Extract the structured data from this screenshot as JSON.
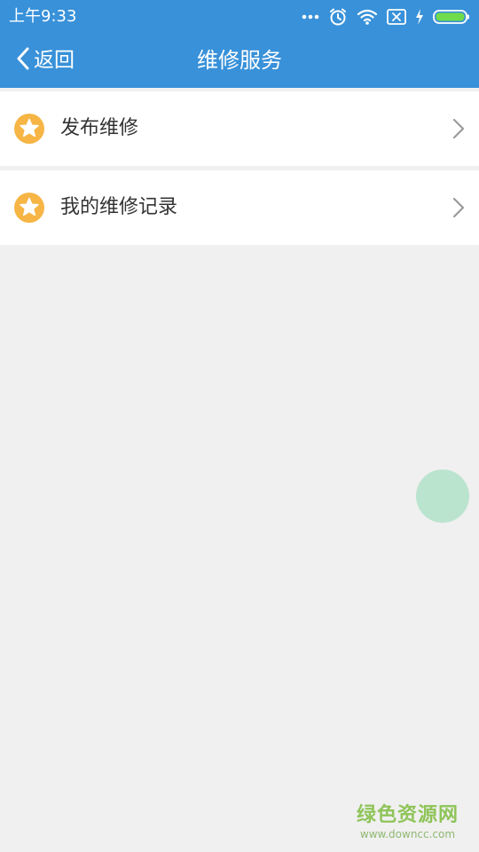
{
  "status_bar": {
    "time": "上午9:33",
    "icons": [
      "more-dots-icon",
      "alarm-icon",
      "wifi-icon",
      "no-sim-icon",
      "charging-icon",
      "battery-icon"
    ]
  },
  "header": {
    "back_label": "返回",
    "title": "维修服务"
  },
  "menu": {
    "items": [
      {
        "label": "发布维修",
        "icon": "star-icon"
      },
      {
        "label": "我的维修记录",
        "icon": "star-icon"
      }
    ]
  },
  "colors": {
    "header": "#3891d9",
    "background": "#f0f0f0",
    "star_badge": "#f6b545",
    "float_button": "#b7e3cc",
    "watermark": "#8fc45a"
  },
  "watermark": {
    "name": "绿色资源网",
    "url": "www.downcc.com"
  }
}
